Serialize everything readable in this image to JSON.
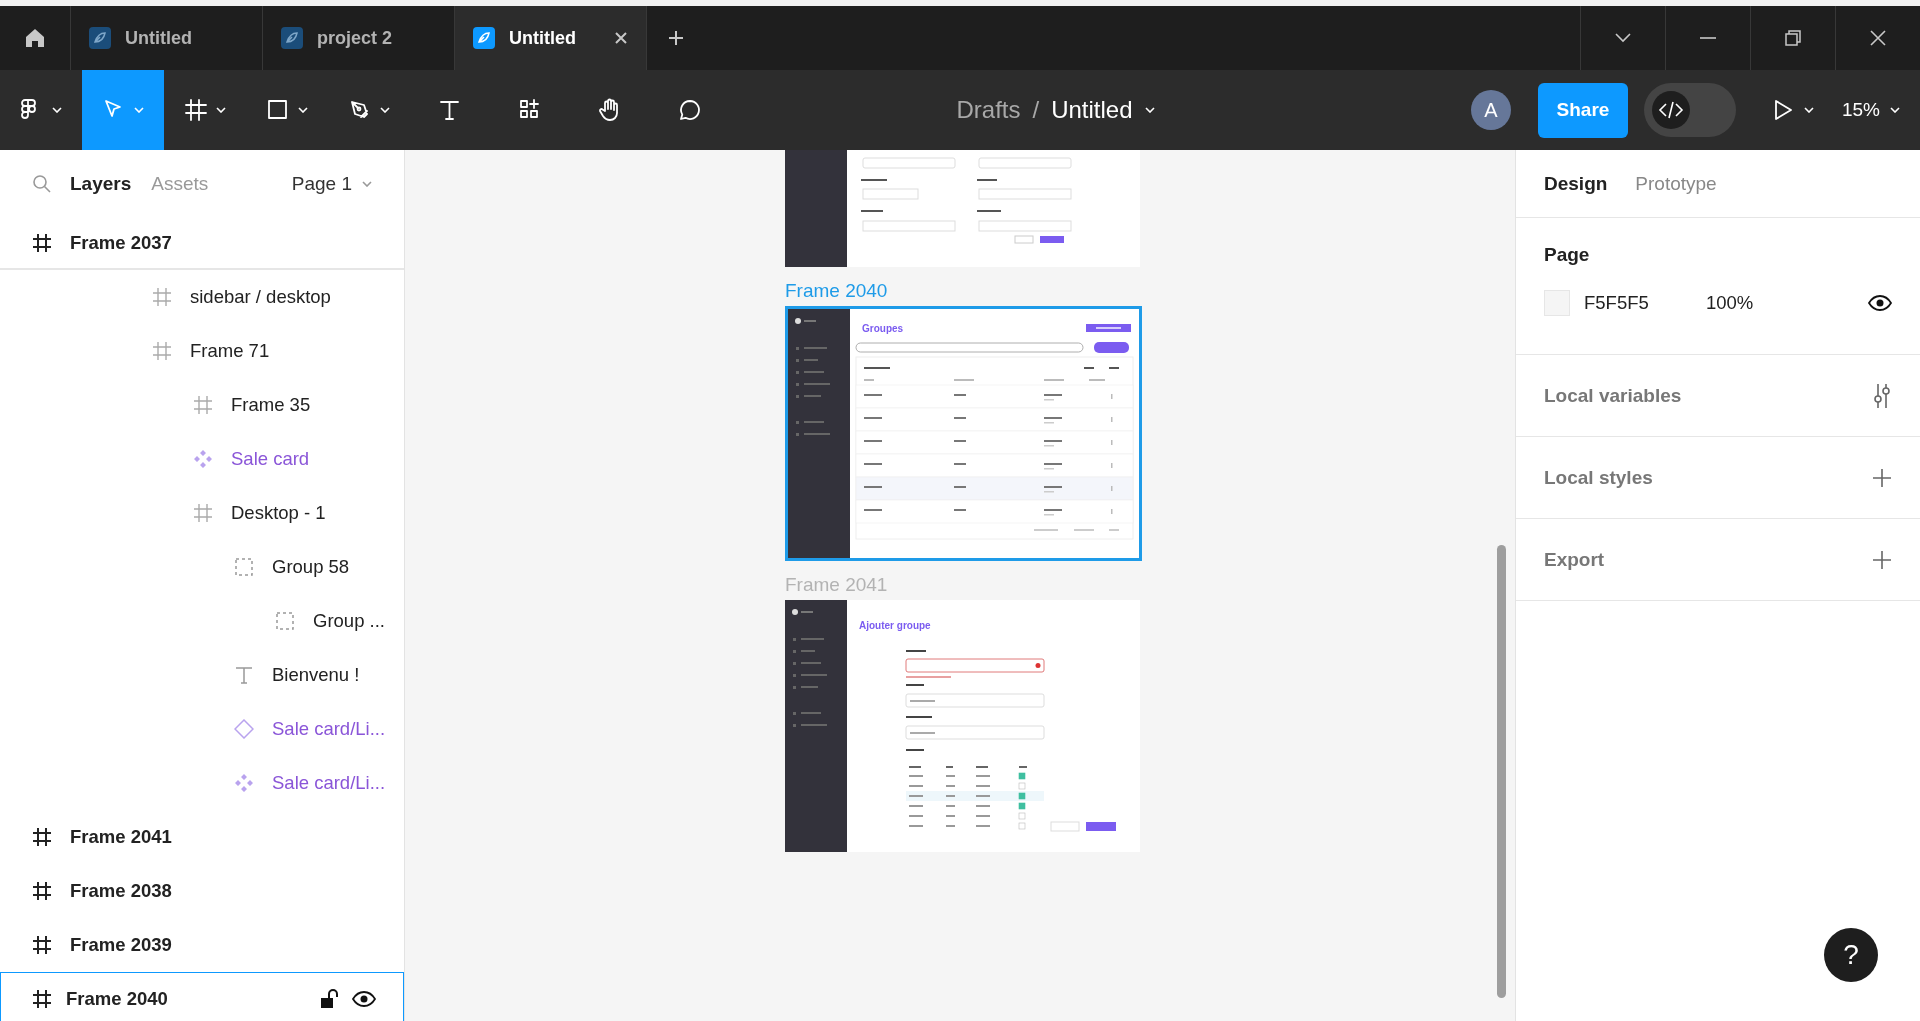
{
  "tab_bar": {
    "tabs": [
      {
        "title": "Untitled",
        "selected": false
      },
      {
        "title": "project 2",
        "selected": false
      },
      {
        "title": "Untitled",
        "selected": true
      }
    ]
  },
  "toolbar": {
    "tools": [
      {
        "kind": "main-menu",
        "selected": false
      },
      {
        "kind": "move",
        "selected": true
      },
      {
        "kind": "frame",
        "selected": false
      },
      {
        "kind": "shape",
        "selected": false
      },
      {
        "kind": "pen",
        "selected": false
      },
      {
        "kind": "text",
        "selected": false
      },
      {
        "kind": "resources",
        "selected": false
      },
      {
        "kind": "hand",
        "selected": false
      },
      {
        "kind": "comment",
        "selected": false
      }
    ],
    "breadcrumb": {
      "folder": "Drafts",
      "separator": "/",
      "file": "Untitled"
    },
    "avatar": "A",
    "share": "Share",
    "dev_mode": false,
    "zoom": "15%"
  },
  "layers_panel": {
    "tabs": [
      {
        "label": "Layers",
        "selected": true
      },
      {
        "label": "Assets",
        "selected": false
      }
    ],
    "page": "Page 1",
    "layers": [
      {
        "name": "Frame 2037",
        "kind": "frame",
        "selected": false,
        "children": [
          {
            "name": "sidebar / desktop",
            "kind": "frame",
            "selected": false
          },
          {
            "name": "Frame 71",
            "kind": "frame",
            "selected": false,
            "children": [
              {
                "name": "Frame 35",
                "kind": "frame",
                "selected": false
              },
              {
                "name": "Sale card",
                "kind": "component",
                "selected": false
              },
              {
                "name": "Desktop - 1",
                "kind": "frame",
                "selected": false,
                "children": [
                  {
                    "name": "Group 58",
                    "kind": "group",
                    "selected": false,
                    "children": [
                      {
                        "name": "Group ...",
                        "kind": "group",
                        "selected": false
                      }
                    ]
                  },
                  {
                    "name": "Bienvenu !",
                    "kind": "text",
                    "selected": false
                  },
                  {
                    "name": "Sale card/Li...",
                    "kind": "instance",
                    "selected": false
                  },
                  {
                    "name": "Sale card/Li...",
                    "kind": "component",
                    "selected": false
                  }
                ]
              }
            ]
          }
        ]
      },
      {
        "name": "Frame 2041",
        "kind": "frame",
        "selected": false
      },
      {
        "name": "Frame 2038",
        "kind": "frame",
        "selected": false
      },
      {
        "name": "Frame 2039",
        "kind": "frame",
        "selected": false
      },
      {
        "name": "Frame 2040",
        "kind": "frame",
        "selected": true
      }
    ]
  },
  "canvas": {
    "frames": [
      {
        "kind": "form",
        "selected": false
      },
      {
        "label": "Frame 2040",
        "kind": "list",
        "selected": true,
        "heading": "Groupes"
      },
      {
        "label": "Frame 2041",
        "kind": "add-form",
        "selected": false,
        "heading": "Ajouter groupe",
        "checks": [
          true,
          false,
          true,
          true,
          false,
          false
        ]
      }
    ],
    "help": "?"
  },
  "design_panel": {
    "tabs": [
      {
        "label": "Design",
        "selected": true
      },
      {
        "label": "Prototype",
        "selected": false
      }
    ],
    "page": {
      "title": "Page",
      "color": "#f5f5f5",
      "hex": "F5F5F5",
      "opacity": "100%"
    },
    "sections": [
      {
        "title": "Local variables",
        "kind": "variables"
      },
      {
        "title": "Local styles",
        "kind": "add"
      },
      {
        "title": "Export",
        "kind": "add"
      }
    ]
  }
}
